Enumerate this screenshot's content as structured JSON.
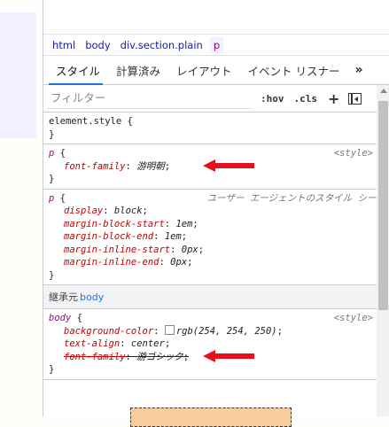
{
  "breadcrumb": {
    "items": [
      "html",
      "body",
      "div.section.plain",
      "p"
    ]
  },
  "tabs": {
    "items": [
      "スタイル",
      "計算済み",
      "レイアウト",
      "イベント リスナー"
    ],
    "more": "»"
  },
  "filter": {
    "placeholder": "フィルター",
    "hov": ":hov",
    "cls": ".cls",
    "plus": "+"
  },
  "rules": {
    "element_style": {
      "selector": "element.style",
      "open": " {",
      "close": "}"
    },
    "p_style": {
      "selector": "p",
      "open": " {",
      "close": "}",
      "source": "<style>",
      "props": [
        {
          "name": "font-family",
          "value": "游明朝"
        }
      ]
    },
    "p_ua": {
      "selector": "p",
      "open": " {",
      "close": "}",
      "source": "ユーザー エージェントのスタイル シート",
      "props": [
        {
          "name": "display",
          "value": "block"
        },
        {
          "name": "margin-block-start",
          "value": "1em"
        },
        {
          "name": "margin-block-end",
          "value": "1em"
        },
        {
          "name": "margin-inline-start",
          "value": "0px"
        },
        {
          "name": "margin-inline-end",
          "value": "0px"
        }
      ]
    },
    "inherited": {
      "label": "継承元",
      "from": "body"
    },
    "body_style": {
      "selector": "body",
      "open": " {",
      "close": "}",
      "source": "<style>",
      "props": [
        {
          "name": "background-color",
          "value": "rgb(254, 254, 250)"
        },
        {
          "name": "text-align",
          "value": "center"
        },
        {
          "name": "font-family",
          "value": "游ゴシック"
        }
      ]
    }
  },
  "colors": {
    "arrow": "#e8111b",
    "selector": "#881280",
    "property": "#c80000",
    "accent": "#1a73e8"
  }
}
